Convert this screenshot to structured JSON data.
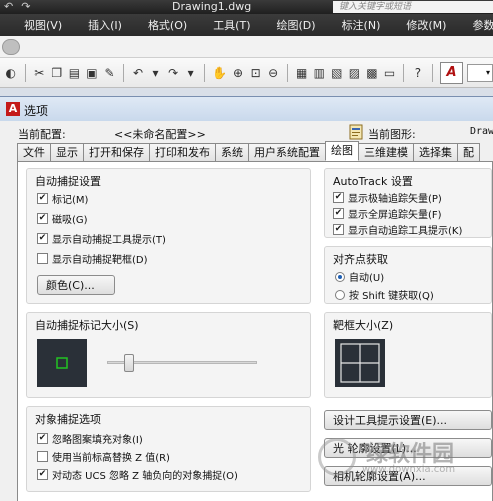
{
  "titlebar": {
    "quick_undo": "↶",
    "quick_redo": "↷",
    "document": "Drawing1.dwg",
    "search_placeholder": "键入关键字或短语"
  },
  "menu": [
    "视图(V)",
    "插入(I)",
    "格式(O)",
    "工具(T)",
    "绘图(D)",
    "标注(N)",
    "修改(M)",
    "参数(P)"
  ],
  "dialog": {
    "title": "选项",
    "profile_label": "当前配置:",
    "profile_value": "<<未命名配置>>",
    "drawing_label": "当前图形:",
    "drawing_value": "Draw",
    "tabs": [
      {
        "label": "文件",
        "active": false
      },
      {
        "label": "显示",
        "active": false
      },
      {
        "label": "打开和保存",
        "active": false
      },
      {
        "label": "打印和发布",
        "active": false
      },
      {
        "label": "系统",
        "active": false
      },
      {
        "label": "用户系统配置",
        "active": false
      },
      {
        "label": "绘图",
        "active": true
      },
      {
        "label": "三维建模",
        "active": false
      },
      {
        "label": "选择集",
        "active": false
      },
      {
        "label": "配",
        "active": false
      }
    ]
  },
  "autosnap": {
    "title": "自动捕捉设置",
    "items": [
      {
        "label": "标记(M)",
        "checked": true
      },
      {
        "label": "磁吸(G)",
        "checked": true
      },
      {
        "label": "显示自动捕捉工具提示(T)",
        "checked": true
      },
      {
        "label": "显示自动捕捉靶框(D)",
        "checked": false
      }
    ],
    "color_button": "颜色(C)..."
  },
  "autotrack": {
    "title": "AutoTrack 设置",
    "items": [
      {
        "label": "显示极轴追踪矢量(P)",
        "checked": true
      },
      {
        "label": "显示全屏追踪矢量(F)",
        "checked": true
      },
      {
        "label": "显示自动追踪工具提示(K)",
        "checked": true
      }
    ]
  },
  "alignment": {
    "title": "对齐点获取",
    "options": [
      {
        "label": "自动(U)",
        "selected": true
      },
      {
        "label": "按 Shift 键获取(Q)",
        "selected": false
      }
    ]
  },
  "marker_size": {
    "title": "自动捕捉标记大小(S)",
    "slider_fraction": 0.12
  },
  "aperture_size": {
    "title": "靶框大小(Z)"
  },
  "osnap": {
    "title": "对象捕捉选项",
    "items": [
      {
        "label": "忽略图案填充对象(I)",
        "checked": true
      },
      {
        "label": "使用当前标高替换 Z 值(R)",
        "checked": false
      },
      {
        "label": "对动态 UCS 忽略 Z 轴负向的对象捕捉(O)",
        "checked": true
      }
    ]
  },
  "buttons": {
    "design_tooltip": "设计工具提示设置(E)...",
    "light_glyph": "光 轮廓设置(L)...",
    "camera_glyph": "相机轮廓设置(A)..."
  },
  "watermark": {
    "big": "绿软件园",
    "small": "www.downxia.com"
  },
  "colors": {
    "dark_bar": "#2a2a2a",
    "dialog_bg": "#f0f0f0",
    "preview_bg": "#2a3038",
    "marker_green": "#22c322",
    "accent_red": "#c41a1a"
  }
}
